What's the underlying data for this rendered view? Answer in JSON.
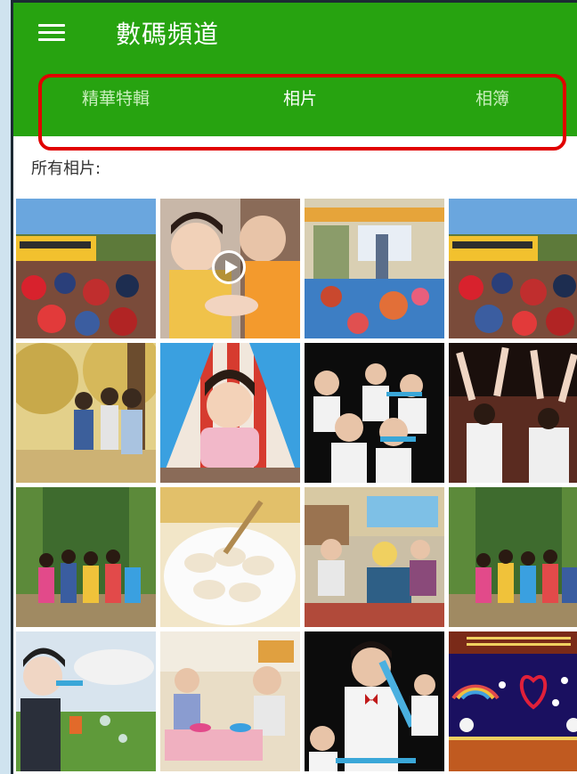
{
  "app": {
    "title": "數碼頻道"
  },
  "tabs": [
    {
      "label": "精華特輯",
      "active": false
    },
    {
      "label": "相片",
      "active": true
    },
    {
      "label": "相簿",
      "active": false
    }
  ],
  "section": {
    "label": "所有相片:"
  },
  "colors": {
    "appbar": "#27a310",
    "highlight": "#e10000"
  },
  "photos": [
    {
      "name": "school-bus-crowd-photo",
      "video": false
    },
    {
      "name": "children-hands-video",
      "video": true
    },
    {
      "name": "classroom-teacher-photo",
      "video": false
    },
    {
      "name": "school-bus-crowd-photo-2",
      "video": false
    },
    {
      "name": "children-walking-trees-photo",
      "video": false
    },
    {
      "name": "child-in-tent-photo",
      "video": false
    },
    {
      "name": "children-playing-recorders-photo",
      "video": false
    },
    {
      "name": "stage-performance-photo",
      "video": false
    },
    {
      "name": "children-bamboo-path-photo",
      "video": false
    },
    {
      "name": "dumplings-plate-photo",
      "video": false
    },
    {
      "name": "parents-classroom-photo",
      "video": false
    },
    {
      "name": "children-bamboo-path-photo-2",
      "video": false
    },
    {
      "name": "child-blowing-bubbles-photo",
      "video": false
    },
    {
      "name": "children-craft-table-photo",
      "video": false
    },
    {
      "name": "boy-bowtie-recorder-photo",
      "video": false
    },
    {
      "name": "stage-rainbow-decor-photo",
      "video": false
    }
  ]
}
